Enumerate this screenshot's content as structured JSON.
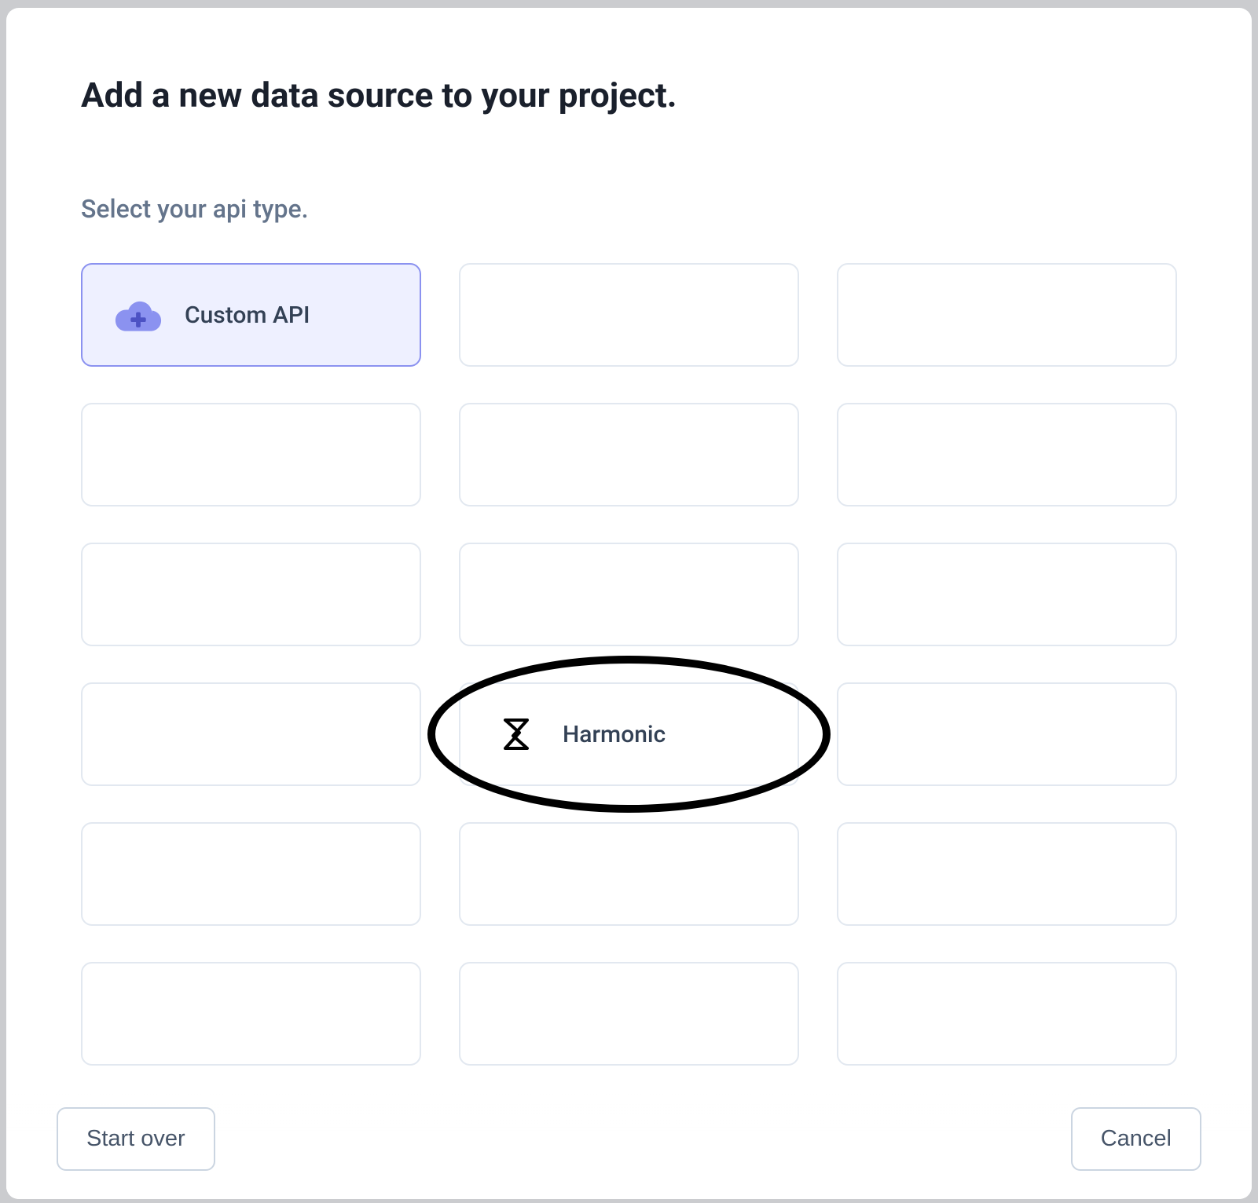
{
  "modal": {
    "title": "Add a new data source to your project.",
    "subtitle": "Select your api type.",
    "cards": [
      {
        "label": "Custom API",
        "icon": "cloud-plus",
        "selected": true
      },
      {
        "label": "",
        "icon": "",
        "selected": false
      },
      {
        "label": "",
        "icon": "",
        "selected": false
      },
      {
        "label": "",
        "icon": "",
        "selected": false
      },
      {
        "label": "",
        "icon": "",
        "selected": false
      },
      {
        "label": "",
        "icon": "",
        "selected": false
      },
      {
        "label": "",
        "icon": "",
        "selected": false
      },
      {
        "label": "",
        "icon": "",
        "selected": false
      },
      {
        "label": "",
        "icon": "",
        "selected": false
      },
      {
        "label": "",
        "icon": "",
        "selected": false
      },
      {
        "label": "Harmonic",
        "icon": "harmonic",
        "selected": false,
        "highlighted": true
      },
      {
        "label": "",
        "icon": "",
        "selected": false
      },
      {
        "label": "",
        "icon": "",
        "selected": false
      },
      {
        "label": "",
        "icon": "",
        "selected": false
      },
      {
        "label": "",
        "icon": "",
        "selected": false
      },
      {
        "label": "",
        "icon": "",
        "selected": false
      },
      {
        "label": "",
        "icon": "",
        "selected": false
      },
      {
        "label": "",
        "icon": "",
        "selected": false
      },
      {
        "label": "",
        "icon": "",
        "selected": false
      },
      {
        "label": "",
        "icon": "",
        "selected": false
      },
      {
        "label": "",
        "icon": "",
        "selected": false
      }
    ],
    "footer": {
      "start_over_label": "Start over",
      "cancel_label": "Cancel"
    }
  }
}
